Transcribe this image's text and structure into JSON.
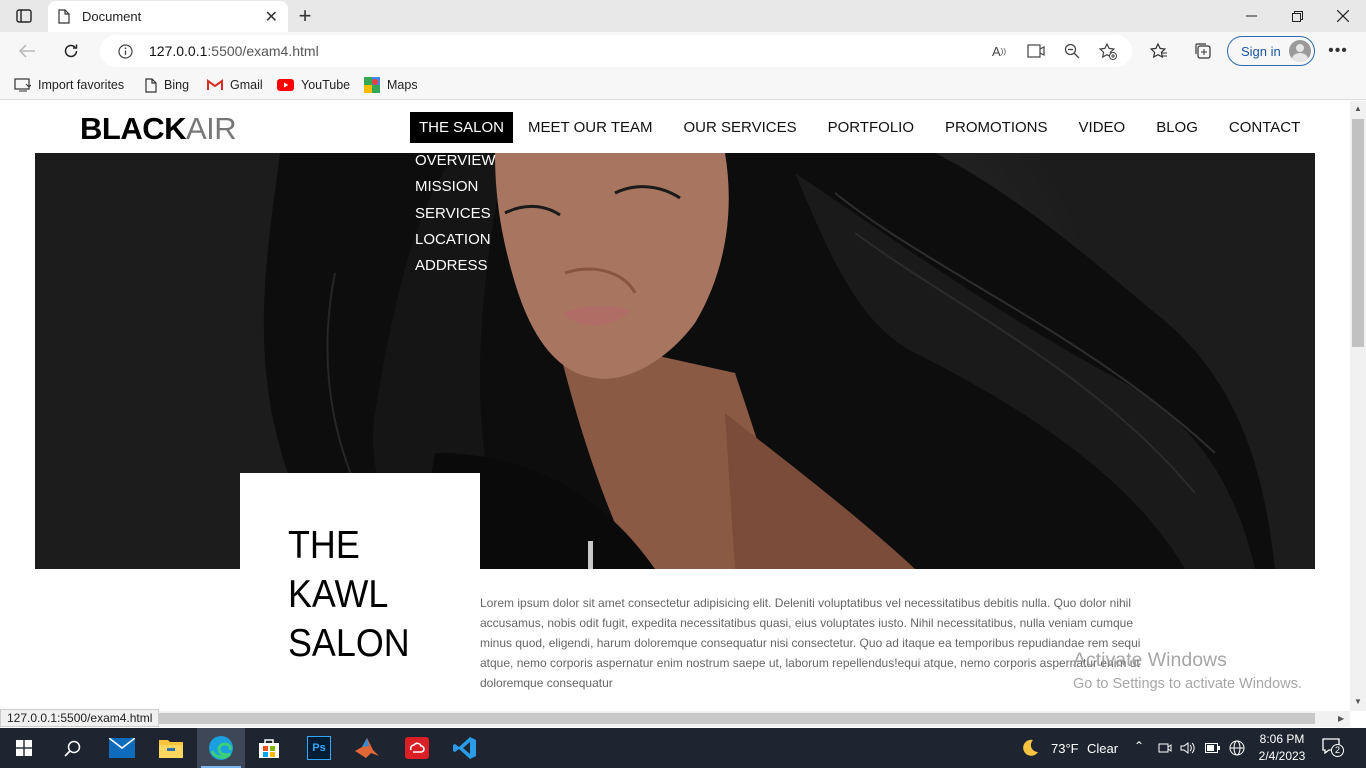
{
  "browser": {
    "tab_title": "Document",
    "address_host": "127.0.0.1",
    "address_path": ":5500/exam4.html",
    "signin_label": "Sign in",
    "favorites": [
      "Import favorites",
      "Bing",
      "Gmail",
      "YouTube",
      "Maps"
    ],
    "status_url": "127.0.0.1:5500/exam4.html"
  },
  "page": {
    "logo_bold": "BLACK",
    "logo_light": "AIR",
    "nav": [
      "THE SALON",
      "MEET OUR TEAM",
      "OUR SERVICES",
      "PORTFOLIO",
      "PROMOTIONS",
      "VIDEO",
      "BLOG",
      "CONTACT"
    ],
    "active_nav": "THE SALON",
    "dropdown": [
      "OVERVIEW",
      "MISSION",
      "SERVICES",
      "LOCATION",
      "ADDRESS"
    ],
    "salon_title_lines": [
      "THE",
      "KAWL",
      "SALON"
    ],
    "lorem": "Lorem ipsum dolor sit amet consectetur adipisicing elit. Deleniti voluptatibus vel necessitatibus debitis nulla. Quo dolor nihil accusamus, nobis odit fugit, expedita necessitatibus quasi, eius voluptates iusto. Nihil necessitatibus, nulla veniam cumque minus quod, eligendi, harum doloremque consequatur nisi consectetur. Quo ad itaque ea temporibus repudiandae rem sequi atque, nemo corporis aspernatur enim nostrum saepe ut, laborum repellendus!equi atque, nemo corporis aspernatur enim ut doloremque consequatur"
  },
  "watermark": {
    "line1": "Activate Windows",
    "line2": "Go to Settings to activate Windows."
  },
  "taskbar": {
    "weather": "73°F",
    "weather_desc": "Clear",
    "time": "8:06 PM",
    "date": "2/4/2023",
    "notifications": "2"
  },
  "colors": {
    "nav_active_bg": "#000000",
    "signin_blue": "#1a56a6",
    "taskbar_bg": "#1f2530"
  }
}
